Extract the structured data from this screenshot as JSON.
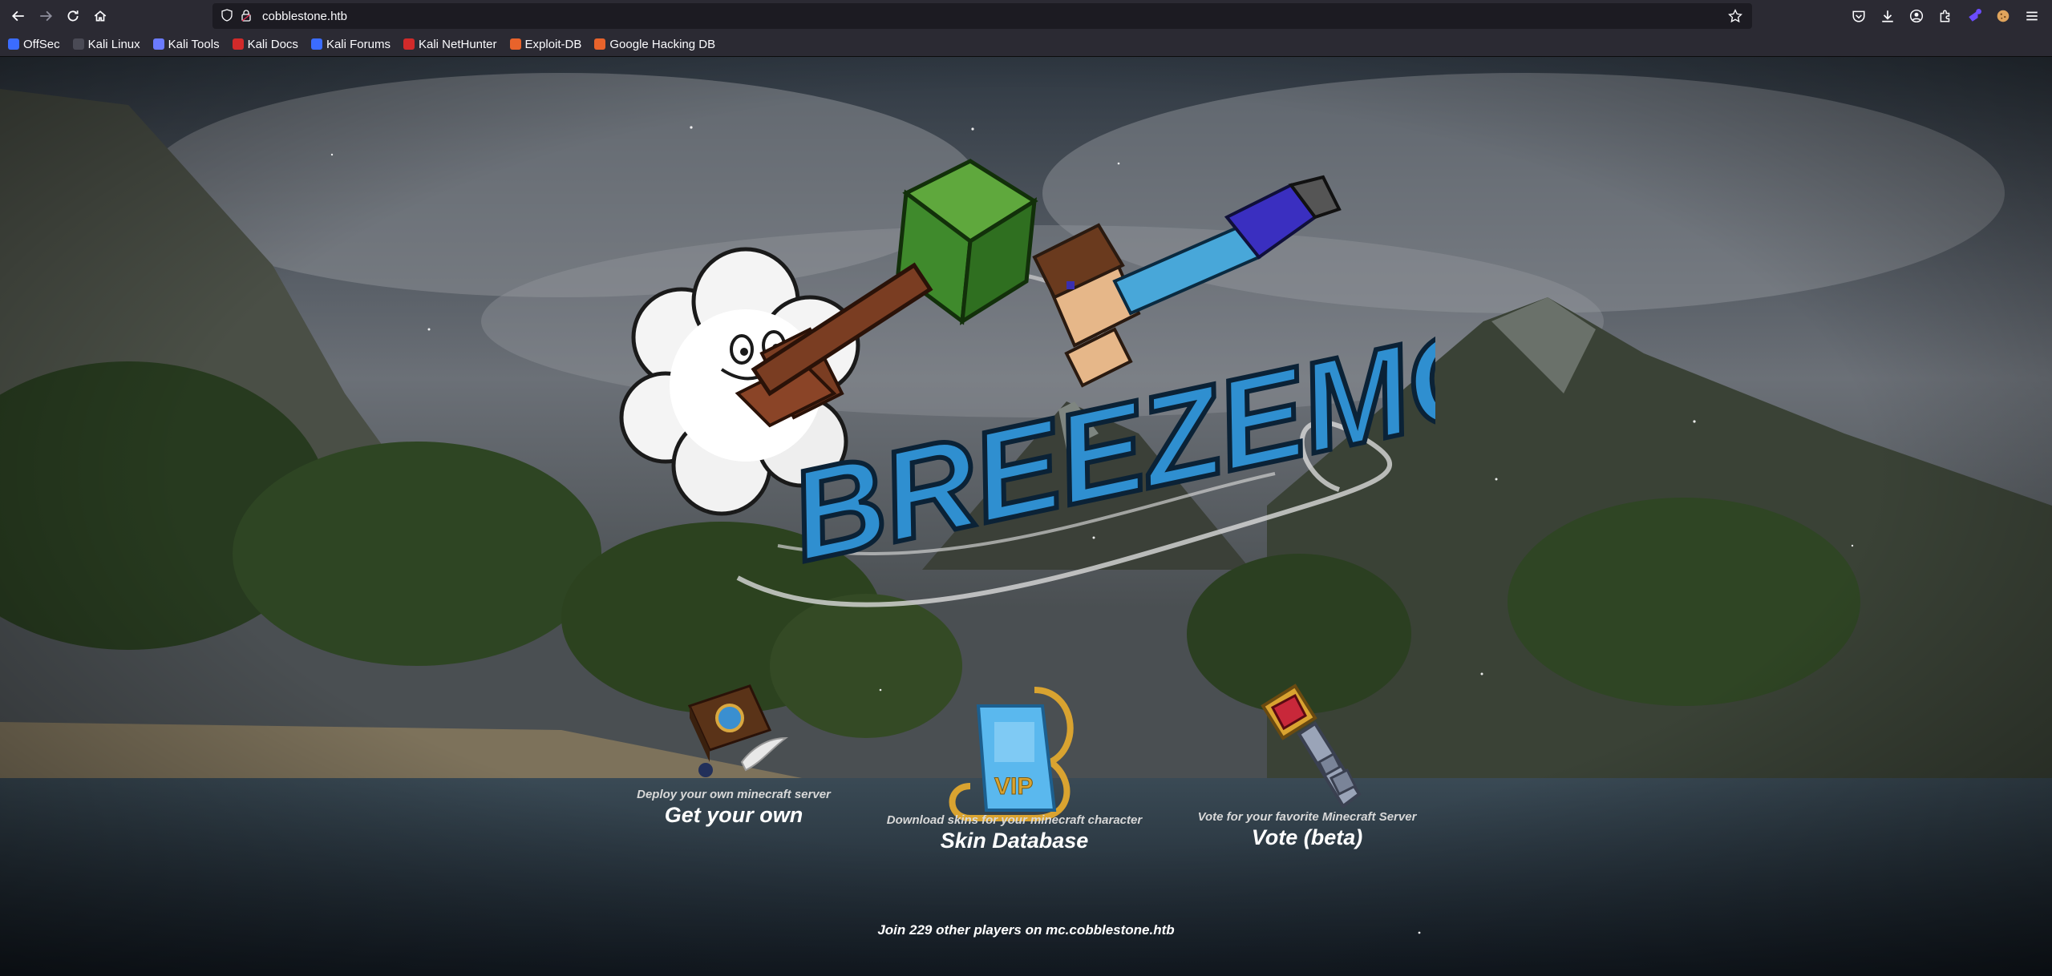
{
  "browser": {
    "url": "cobblestone.htb",
    "bookmarks": [
      {
        "label": "OffSec",
        "color": "#3b6cff"
      },
      {
        "label": "Kali Linux",
        "color": "#6b7bff"
      },
      {
        "label": "Kali Tools",
        "color": "#6b7bff"
      },
      {
        "label": "Kali Docs",
        "color": "#d12a2a"
      },
      {
        "label": "Kali Forums",
        "color": "#3b6cff"
      },
      {
        "label": "Kali NetHunter",
        "color": "#d12a2a"
      },
      {
        "label": "Exploit-DB",
        "color": "#e8632b"
      },
      {
        "label": "Google Hacking DB",
        "color": "#e8632b"
      }
    ]
  },
  "hero": {
    "logo_text": "BREEZEMC"
  },
  "features": [
    {
      "subtitle": "Deploy your own minecraft server",
      "title": "Get your own",
      "icon": "spellbook-icon"
    },
    {
      "subtitle": "Download skins for your minecraft character",
      "title": "Skin Database",
      "icon": "vip-tag-icon"
    },
    {
      "subtitle": "Vote for your favorite Minecraft Server",
      "title": "Vote (beta)",
      "icon": "key-icon"
    }
  ],
  "footer": {
    "join_text": "Join 229 other players on mc.cobblestone.htb"
  },
  "colors": {
    "chrome": "#2b2a33",
    "urlbar": "#1c1b22",
    "logo_blue": "#2f8fd0",
    "cube_green": "#3f8a2c"
  }
}
